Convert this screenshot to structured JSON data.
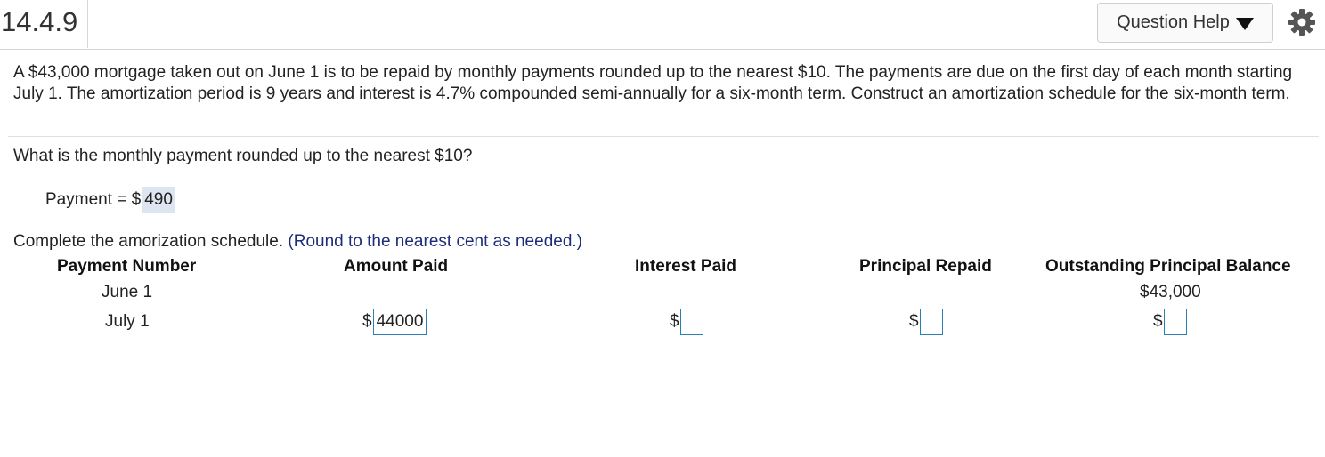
{
  "header": {
    "question_number": "14.4.9",
    "help_label": "Question Help",
    "help_icon": "triangle-down-icon",
    "settings_icon": "gear-icon"
  },
  "problem": {
    "text": "A $43,000 mortgage taken out on June 1 is to be repaid by monthly payments rounded up to the nearest $10. The payments are due on the first day of each month starting July 1. The amortization period is 9 years and interest is 4.7% compounded semi-annually for a six-month term. Construct an amortization schedule for the six-month term."
  },
  "part1": {
    "question": "What is the monthly payment rounded up to the nearest $10?",
    "label": "Payment = $",
    "answer": "490"
  },
  "part2": {
    "instruction": "Complete the amorization schedule.",
    "hint": "(Round to the nearest cent as needed.)",
    "columns": [
      "Payment Number",
      "Amount Paid",
      "Interest Paid",
      "Principal Repaid",
      "Outstanding Principal Balance"
    ],
    "rows": [
      {
        "payment_number": "June 1",
        "outstanding_balance": "$43,000"
      },
      {
        "payment_number": "July 1",
        "currency": "$",
        "amount_paid": "44000",
        "interest_paid": "",
        "principal_repaid": "",
        "outstanding_balance": ""
      }
    ]
  }
}
